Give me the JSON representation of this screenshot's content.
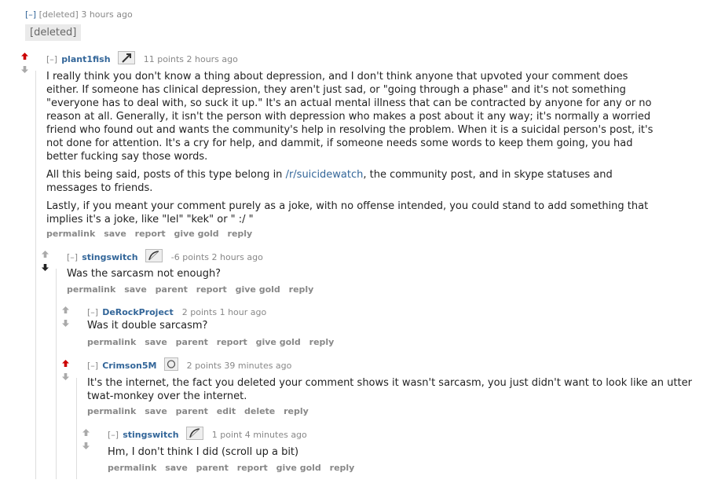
{
  "deleted_comment": {
    "toggle": "[–]",
    "author": "[deleted]",
    "time": "3 hours ago",
    "body": "[deleted]"
  },
  "comment1": {
    "toggle": "[–]",
    "author": "plant1fish",
    "flair_icon": "pickaxe-icon",
    "meta": "11 points 2 hours ago",
    "p1": "I really think you don't know a thing about depression, and I don't think anyone that upvoted your comment does either. If someone has clinical depression, they aren't just sad, or \"going through a phase\" and it's not something \"everyone has to deal with, so suck it up.\" It's an actual mental illness that can be contracted by anyone for any or no reason at all. Generally, it isn't the person with depression who makes a post about it any way; it's normally a worried friend who found out and wants the community's help in resolving the problem. When it is a suicidal person's post, it's not done for attention. It's a cry for help, and dammit, if someone needs some words to keep them going, you had better fucking say those words.",
    "p2_pre": "All this being said, posts of this type belong in ",
    "p2_link": "/r/suicidewatch",
    "p2_post": ", the community post, and in skype statuses and messages to friends.",
    "p3": "Lastly, if you meant your comment purely as a joke, with no offense intended, you could stand to add something that implies it's a joke, like \"lel\" \"kek\" or \" :/ \"",
    "buttons": [
      "permalink",
      "save",
      "report",
      "give gold",
      "reply"
    ]
  },
  "comment2": {
    "toggle": "[–]",
    "author": "stingswitch",
    "flair_icon": "bow-icon",
    "meta": "-6 points 2 hours ago",
    "body": "Was the sarcasm not enough?",
    "buttons": [
      "permalink",
      "save",
      "parent",
      "report",
      "give gold",
      "reply"
    ]
  },
  "comment3": {
    "toggle": "[–]",
    "author": "DeRockProject",
    "meta": "2 points 1 hour ago",
    "body": "Was it double sarcasm?",
    "buttons": [
      "permalink",
      "save",
      "parent",
      "report",
      "give gold",
      "reply"
    ]
  },
  "comment4": {
    "toggle": "[–]",
    "author": "Crimson5M",
    "flair_icon": "ring-icon",
    "meta": "2 points 39 minutes ago",
    "body": "It's the internet, the fact you deleted your comment shows it wasn't sarcasm, you just didn't want to look like an utter twat-monkey over the internet.",
    "buttons": [
      "permalink",
      "save",
      "parent",
      "edit",
      "delete",
      "reply"
    ]
  },
  "comment5": {
    "toggle": "[–]",
    "author": "stingswitch",
    "flair_icon": "bow-icon",
    "meta": "1 point 4 minutes ago",
    "body": "Hm, I don't think I did (scroll up a bit)",
    "buttons": [
      "permalink",
      "save",
      "parent",
      "report",
      "give gold",
      "reply"
    ]
  },
  "colors": {
    "upvoted": "#cc0000",
    "neutral_arrow": "#aaaaaa",
    "link": "#336699"
  }
}
